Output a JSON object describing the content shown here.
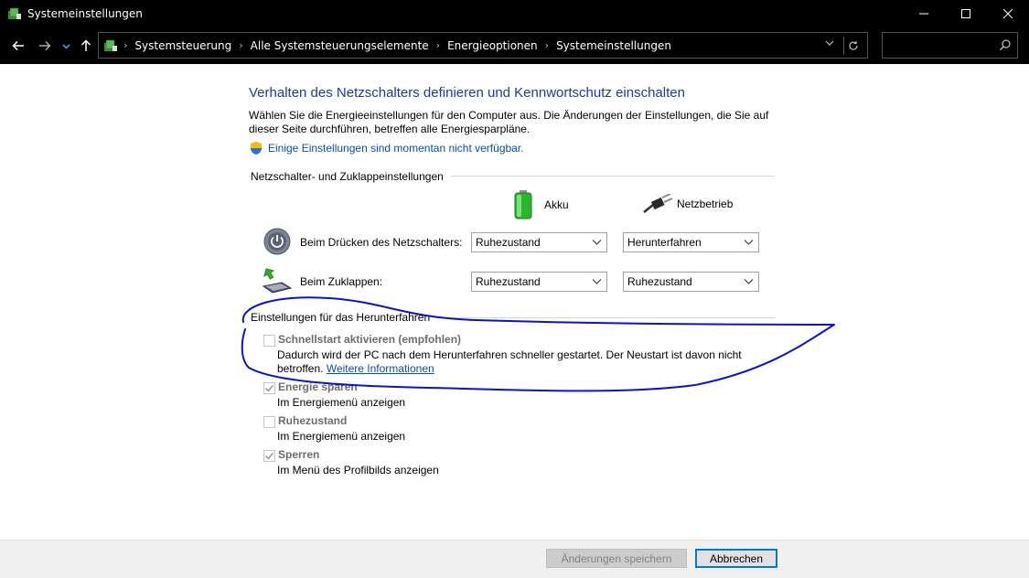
{
  "window": {
    "title": "Systemeinstellungen"
  },
  "breadcrumbs": [
    "Systemsteuerung",
    "Alle Systemsteuerungselemente",
    "Energieoptionen",
    "Systemeinstellungen"
  ],
  "search": {
    "placeholder": ""
  },
  "page": {
    "heading": "Verhalten des Netzschalters definieren und Kennwortschutz einschalten",
    "description": "Wählen Sie die Energieeinstellungen für den Computer aus. Die Änderungen der Einstellungen, die Sie auf dieser Seite durchführen, betreffen alle Energiesparpläne.",
    "admin_link": "Einige Einstellungen sind momentan nicht verfügbar."
  },
  "power_section": {
    "title": "Netzschalter- und Zuklappeinstellungen",
    "col_battery": "Akku",
    "col_ac": "Netzbetrieb",
    "rows": [
      {
        "label": "Beim Drücken des Netzschalters:",
        "battery": "Ruhezustand",
        "ac": "Herunterfahren"
      },
      {
        "label": "Beim Zuklappen:",
        "battery": "Ruhezustand",
        "ac": "Ruhezustand"
      }
    ]
  },
  "shutdown_section": {
    "title": "Einstellungen für das Herunterfahren",
    "options": [
      {
        "label": "Schnellstart aktivieren (empfohlen)",
        "checked": false,
        "desc": "Dadurch wird der PC nach dem Herunterfahren schneller gestartet. Der Neustart ist davon nicht",
        "desc2": "betroffen.",
        "link": "Weitere Informationen"
      },
      {
        "label": "Energie sparen",
        "checked": true,
        "desc": "Im Energiemenü anzeigen"
      },
      {
        "label": "Ruhezustand",
        "checked": false,
        "desc": "Im Energiemenü anzeigen"
      },
      {
        "label": "Sperren",
        "checked": true,
        "desc": "Im Menü des Profilbilds anzeigen"
      }
    ]
  },
  "buttons": {
    "save": "Änderungen speichern",
    "cancel": "Abbrechen"
  },
  "colors": {
    "heading": "#1e3b96",
    "link": "#0a50a0",
    "annotation": "#0a14c8"
  }
}
